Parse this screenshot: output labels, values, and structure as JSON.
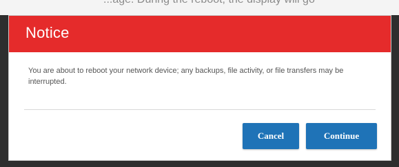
{
  "page": {
    "background_text": "...age. During the reboot, the display will go"
  },
  "dialog": {
    "title": "Notice",
    "message": "You are about to reboot your network device; any backups, file activity, or file transfers may be interrupted.",
    "header_color": "#e52b2b",
    "buttons": {
      "cancel_label": "Cancel",
      "continue_label": "Continue",
      "button_color": "#1f73b7"
    }
  }
}
